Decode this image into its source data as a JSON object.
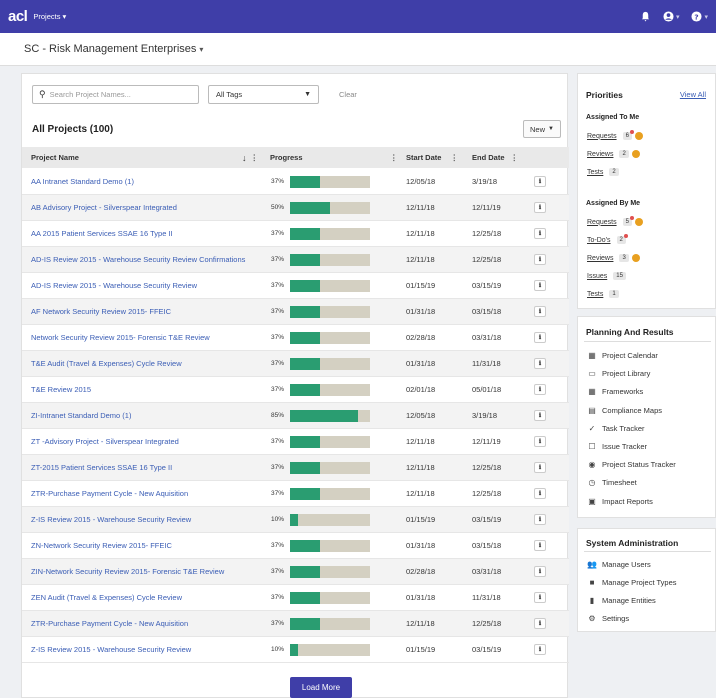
{
  "topbar": {
    "logo": "acl",
    "menu_label": "Projects",
    "bell_icon": "bell-icon",
    "user_icon": "user-icon",
    "help_icon": "help-icon"
  },
  "subheader": {
    "org_title": "SC - Risk Management Enterprises"
  },
  "toolbar": {
    "search_placeholder": "Search Project Names...",
    "tags_value": "All Tags",
    "clear_label": "Clear",
    "title": "All Projects (100)",
    "new_label": "New"
  },
  "table": {
    "columns": [
      "Project Name",
      "Progress",
      "Start Date",
      "End Date"
    ],
    "rows": [
      {
        "name": "AA Intranet Standard Demo (1)",
        "progress": "37%",
        "progress_value": 0.37,
        "start": "12/05/18",
        "end": "3/19/18"
      },
      {
        "name": "AB Advisory Project - Silverspear Integrated",
        "progress": "50%",
        "progress_value": 0.5,
        "start": "12/11/18",
        "end": "12/11/19"
      },
      {
        "name": "AA 2015 Patient Services SSAE 16 Type II",
        "progress": "37%",
        "progress_value": 0.37,
        "start": "12/11/18",
        "end": "12/25/18"
      },
      {
        "name": "AD-IS Review 2015 - Warehouse  Security Review Confirmations",
        "progress": "37%",
        "progress_value": 0.37,
        "start": "12/11/18",
        "end": "12/25/18"
      },
      {
        "name": "AD-IS Review 2015 - Warehouse Security Review",
        "progress": "37%",
        "progress_value": 0.37,
        "start": "01/15/19",
        "end": "03/15/19"
      },
      {
        "name": "AF Network Security Review 2015- FFEIC",
        "progress": "37%",
        "progress_value": 0.37,
        "start": "01/31/18",
        "end": "03/15/18"
      },
      {
        "name": "Network Security Review 2015- Forensic T&E Review",
        "progress": "37%",
        "progress_value": 0.37,
        "start": "02/28/18",
        "end": "03/31/18"
      },
      {
        "name": "T&E Audit (Travel & Expenses) Cycle Review",
        "progress": "37%",
        "progress_value": 0.37,
        "start": "01/31/18",
        "end": "11/31/18"
      },
      {
        "name": "T&E Review 2015",
        "progress": "37%",
        "progress_value": 0.37,
        "start": "02/01/18",
        "end": "05/01/18"
      },
      {
        "name": "ZI-Intranet Standard Demo (1)",
        "progress": "85%",
        "progress_value": 0.85,
        "start": "12/05/18",
        "end": "3/19/18"
      },
      {
        "name": "ZT -Advisory Project - Silverspear Integrated",
        "progress": "37%",
        "progress_value": 0.37,
        "start": "12/11/18",
        "end": "12/11/19"
      },
      {
        "name": "ZT-2015 Patient Services SSAE 16 Type II",
        "progress": "37%",
        "progress_value": 0.37,
        "start": "12/11/18",
        "end": "12/25/18"
      },
      {
        "name": "ZTR-Purchase Payment Cycle - New Aquisition",
        "progress": "37%",
        "progress_value": 0.37,
        "start": "12/11/18",
        "end": "12/25/18"
      },
      {
        "name": "Z-IS Review 2015 - Warehouse Security Review",
        "progress": "10%",
        "progress_value": 0.1,
        "start": "01/15/19",
        "end": "03/15/19"
      },
      {
        "name": "ZN-Network Security Review 2015- FFEIC",
        "progress": "37%",
        "progress_value": 0.37,
        "start": "01/31/18",
        "end": "03/15/18"
      },
      {
        "name": "ZIN-Network Security Review 2015- Forensic T&E Review",
        "progress": "37%",
        "progress_value": 0.37,
        "start": "02/28/18",
        "end": "03/31/18"
      },
      {
        "name": "ZEN Audit (Travel & Expenses) Cycle Review",
        "progress": "37%",
        "progress_value": 0.37,
        "start": "01/31/18",
        "end": "11/31/18"
      },
      {
        "name": "ZTR-Purchase Payment Cycle - New Aquisition",
        "progress": "37%",
        "progress_value": 0.37,
        "start": "12/11/18",
        "end": "12/25/18"
      },
      {
        "name": "Z-IS Review 2015 - Warehouse Security Review",
        "progress": "10%",
        "progress_value": 0.1,
        "start": "01/15/19",
        "end": "03/15/19"
      }
    ],
    "load_more": "Load More"
  },
  "priorities": {
    "title": "Priorities",
    "view_all": "View All",
    "assigned_to_me": {
      "label": "Assigned To Me",
      "items": [
        {
          "label": "Requests",
          "count": "6",
          "dot": true,
          "clock": true
        },
        {
          "label": "Reviews",
          "count": "2",
          "dot": false,
          "clock": true
        },
        {
          "label": "Tests",
          "count": "2",
          "dot": false,
          "clock": false
        }
      ]
    },
    "assigned_by_me": {
      "label": "Assigned By Me",
      "items": [
        {
          "label": "Requests",
          "count": "5",
          "dot": true,
          "clock": true
        },
        {
          "label": "To-Do's",
          "count": "2",
          "dot": true,
          "clock": false
        },
        {
          "label": "Reviews",
          "count": "3",
          "dot": false,
          "clock": true
        },
        {
          "label": "Issues",
          "count": "15",
          "dot": false,
          "clock": false
        },
        {
          "label": "Tests",
          "count": "1",
          "dot": false,
          "clock": false
        }
      ]
    }
  },
  "planning": {
    "title": "Planning And Results",
    "items": [
      {
        "label": "Project Calendar",
        "icon": "calendar-icon",
        "glyph": "▦"
      },
      {
        "label": "Project Library",
        "icon": "archive-icon",
        "glyph": "▭"
      },
      {
        "label": "Frameworks",
        "icon": "grid-icon",
        "glyph": "▦"
      },
      {
        "label": "Compliance Maps",
        "icon": "clipboard-icon",
        "glyph": "▤"
      },
      {
        "label": "Task Tracker",
        "icon": "tasks-icon",
        "glyph": "✓"
      },
      {
        "label": "Issue Tracker",
        "icon": "square-icon",
        "glyph": "☐"
      },
      {
        "label": "Project Status Tracker",
        "icon": "status-icon",
        "glyph": "◉"
      },
      {
        "label": "Timesheet",
        "icon": "clock-icon",
        "glyph": "◷"
      },
      {
        "label": "Impact Reports",
        "icon": "copy-icon",
        "glyph": "▣"
      }
    ]
  },
  "sysadmin": {
    "title": "System Administration",
    "items": [
      {
        "label": "Manage Users",
        "icon": "users-icon",
        "glyph": "👥"
      },
      {
        "label": "Manage Project Types",
        "icon": "trash-icon",
        "glyph": "■"
      },
      {
        "label": "Manage Entities",
        "icon": "entities-icon",
        "glyph": "▮"
      },
      {
        "label": "Settings",
        "icon": "gear-icon",
        "glyph": "⚙"
      }
    ]
  },
  "colors": {
    "brand": "#3f3ea8",
    "progress_fill": "#2a9d71",
    "progress_track": "#d4d0c2",
    "link": "#3a5db5"
  }
}
